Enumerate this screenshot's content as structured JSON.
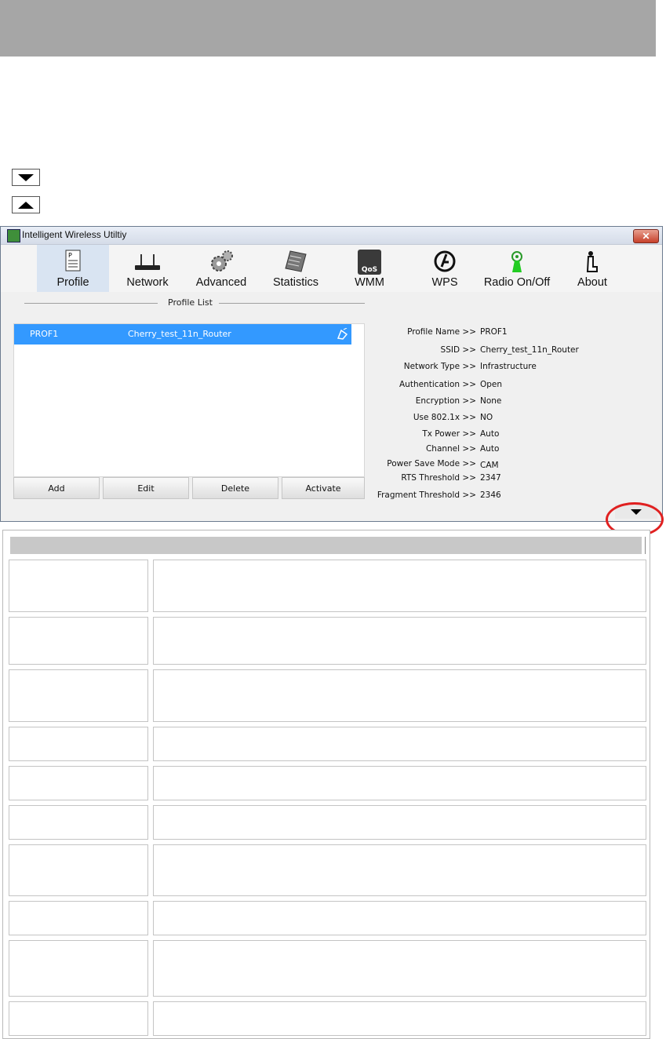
{
  "window": {
    "title": "Intelligent Wireless Utiltiy"
  },
  "toolbar": {
    "items": [
      {
        "label": "Profile",
        "icon": "profile-icon",
        "selected": true
      },
      {
        "label": "Network",
        "icon": "router-icon"
      },
      {
        "label": "Advanced",
        "icon": "gears-icon"
      },
      {
        "label": "Statistics",
        "icon": "statistics-icon"
      },
      {
        "label": "WMM",
        "icon": "qos-icon",
        "icon_text": "QoS"
      },
      {
        "label": "WPS",
        "icon": "wps-icon"
      },
      {
        "label": "Radio On/Off",
        "icon": "radio-icon"
      },
      {
        "label": "About",
        "icon": "about-icon"
      }
    ]
  },
  "profile_list": {
    "title": "Profile List",
    "rows": [
      {
        "name": "PROF1",
        "ssid": "Cherry_test_11n_Router"
      }
    ],
    "buttons": {
      "add": "Add",
      "edit": "Edit",
      "delete": "Delete",
      "activate": "Activate"
    }
  },
  "details": [
    {
      "label": "Profile Name >>",
      "value": "PROF1"
    },
    {
      "label": "SSID >>",
      "value": "Cherry_test_11n_Router"
    },
    {
      "label": "Network Type >>",
      "value": "Infrastructure"
    },
    {
      "label": "Authentication >>",
      "value": "Open"
    },
    {
      "label": "Encryption >>",
      "value": "None"
    },
    {
      "label": "Use 802.1x >>",
      "value": "NO"
    },
    {
      "label": "Tx Power >>",
      "value": "Auto"
    },
    {
      "label": "Channel >>",
      "value": "Auto"
    },
    {
      "label": "Power Save Mode >>",
      "value": "CAM"
    },
    {
      "label": "RTS Threshold >>",
      "value": "2347"
    },
    {
      "label": "Fragment Threshold >>",
      "value": "2346"
    }
  ],
  "colors": {
    "selection": "#3399ff",
    "highlight_circle": "#e02020",
    "header_band": "#a6a6a6"
  }
}
